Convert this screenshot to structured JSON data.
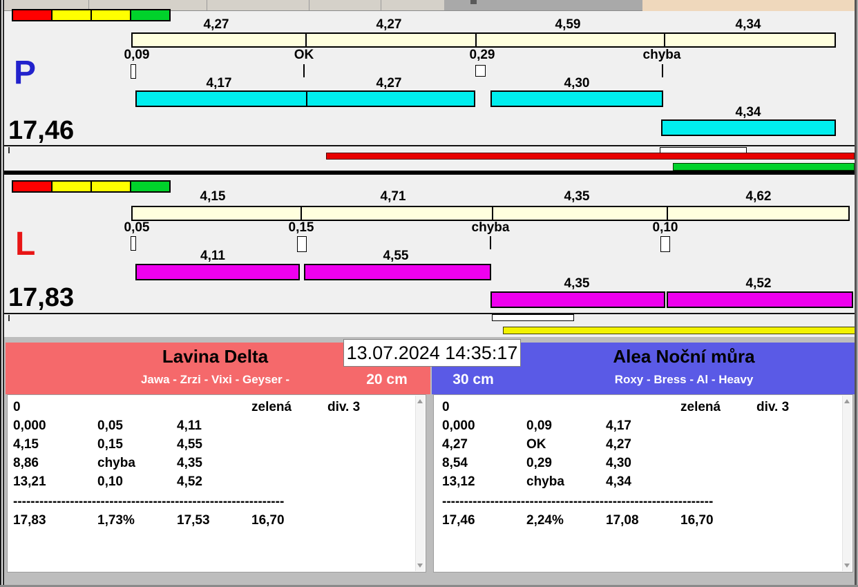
{
  "colors": {
    "panel_bg": "#F0F0F0",
    "scale_bar": "#FFFFDE",
    "lane_p_bar": "#00EEEE",
    "lane_l_bar": "#EE00EE",
    "legend_red": "#FF0000",
    "legend_yellow": "#FFFF00",
    "legend_green": "#00D22B",
    "overflow_red": "#E80000",
    "overflow_green": "#00D22B",
    "overflow_yellow": "#F2F200",
    "lane_p_letter": "#2222CC",
    "lane_l_letter": "#E81515",
    "team_left_header": "#F5696B",
    "team_right_header": "#5A5AE6",
    "taskbar_peach": "#EFD8BC"
  },
  "lanes": {
    "p": {
      "letter": "P",
      "total": "17,46",
      "ref_segments": [
        {
          "label": "4,27"
        },
        {
          "label": "4,27"
        },
        {
          "label": "4,59"
        },
        {
          "label": "4,34"
        }
      ],
      "markers": [
        {
          "label": "0,09"
        },
        {
          "label": "OK"
        },
        {
          "label": "0,29"
        },
        {
          "label": "chyba"
        }
      ],
      "run_segments": [
        {
          "label": "4,17"
        },
        {
          "label": "4,27"
        },
        {
          "label": "4,30"
        },
        {
          "label": "4,34"
        }
      ]
    },
    "l": {
      "letter": "L",
      "total": "17,83",
      "ref_segments": [
        {
          "label": "4,15"
        },
        {
          "label": "4,71"
        },
        {
          "label": "4,35"
        },
        {
          "label": "4,62"
        }
      ],
      "markers": [
        {
          "label": "0,05"
        },
        {
          "label": "0,15"
        },
        {
          "label": "chyba"
        },
        {
          "label": "0,10"
        }
      ],
      "run_segments": [
        {
          "label": "4,11"
        },
        {
          "label": "4,55"
        },
        {
          "label": "4,35"
        },
        {
          "label": "4,52"
        }
      ]
    }
  },
  "footer": {
    "timestamp": "13.07.2024 14:35:17",
    "left": {
      "team": "Lavina Delta",
      "members": "Jawa - Zrzi - Vixi - Geyser -",
      "category": "20 cm",
      "log": {
        "row0": {
          "c1": "0",
          "c4": "zelená",
          "c5": "div. 3"
        },
        "rows": [
          {
            "c1": "0,000",
            "c2": "0,05",
            "c3": "4,11"
          },
          {
            "c1": "4,15",
            "c2": "0,15",
            "c3": "4,55"
          },
          {
            "c1": "8,86",
            "c2": "chyba",
            "c3": "4,35"
          },
          {
            "c1": "13,21",
            "c2": "0,10",
            "c3": "4,52"
          }
        ],
        "separator": "--------------------------------------------------------------",
        "totals": {
          "c1": "17,83",
          "c2": "1,73%",
          "c3": "17,53",
          "c4": "16,70"
        }
      }
    },
    "right": {
      "team": "Alea Noční můra",
      "members": "Roxy - Bress - Al - Heavy",
      "category": "30 cm",
      "log": {
        "row0": {
          "c1": "0",
          "c4": "zelená",
          "c5": "div. 3"
        },
        "rows": [
          {
            "c1": "0,000",
            "c2": "0,09",
            "c3": "4,17"
          },
          {
            "c1": "4,27",
            "c2": "OK",
            "c3": "4,27"
          },
          {
            "c1": "8,54",
            "c2": "0,29",
            "c3": "4,30"
          },
          {
            "c1": "13,12",
            "c2": "chyba",
            "c3": "4,34"
          }
        ],
        "separator": "--------------------------------------------------------------",
        "totals": {
          "c1": "17,46",
          "c2": "2,24%",
          "c3": "17,08",
          "c4": "16,70"
        }
      }
    }
  },
  "icons": {
    "scroll_up": "triangle-up",
    "scroll_down": "triangle-down"
  }
}
